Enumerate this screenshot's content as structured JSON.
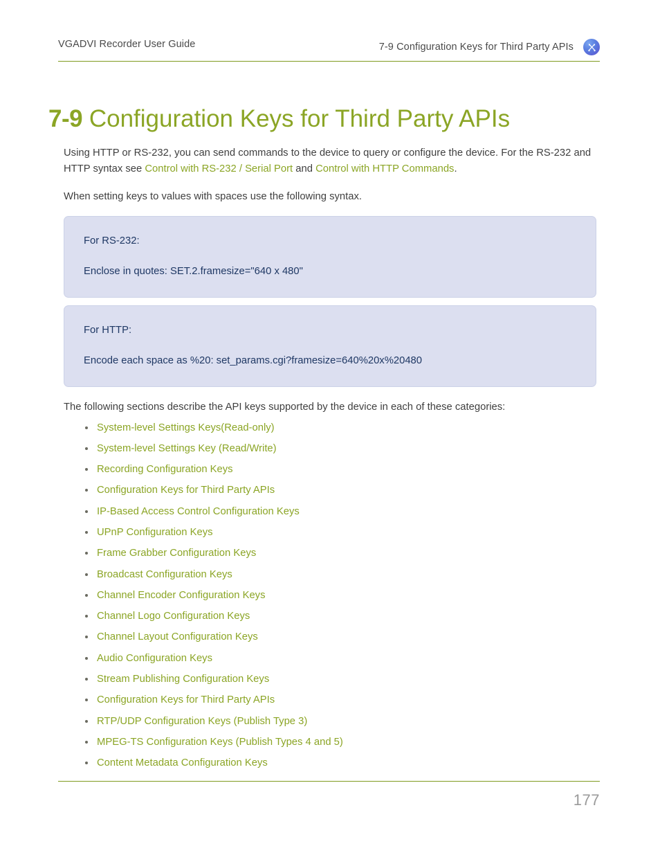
{
  "header": {
    "left_title": "VGADVI Recorder User Guide",
    "right_title": "7-9 Configuration Keys for Third Party APIs",
    "badge_icon": "tools-icon"
  },
  "title": {
    "number": "7-9",
    "text": "Configuration Keys for Third Party APIs"
  },
  "body": {
    "paragraph1_part1": "Using HTTP or RS-232, you can send commands to the device to query or configure the device. For the RS-232 and HTTP syntax see ",
    "paragraph1_link1": "Control with RS-232 / Serial Port",
    "paragraph1_part2": " and ",
    "paragraph1_link2": "Control with HTTP Commands",
    "paragraph1_part3": ".",
    "paragraph2": "When setting keys to values with spaces use the following syntax.",
    "list_intro": "The following sections describe the API keys supported by the device in each of these categories:"
  },
  "callouts": [
    {
      "heading": "For RS-232:",
      "detail": "Enclose in quotes: SET.2.framesize=\"640 x 480\""
    },
    {
      "heading": "For HTTP:",
      "detail": "Encode each space as %20: set_params.cgi?framesize=640%20x%20480"
    }
  ],
  "link_list": [
    {
      "label": "System-level Settings Keys(Read-only)"
    },
    {
      "label": "System-level Settings Key (Read/Write)"
    },
    {
      "label": "Recording Configuration Keys"
    },
    {
      "label": "Configuration Keys for Third Party APIs"
    },
    {
      "label": "IP-Based Access Control Configuration Keys"
    },
    {
      "label": "UPnP Configuration Keys"
    },
    {
      "label": "Frame Grabber Configuration Keys"
    },
    {
      "label": "Broadcast Configuration Keys"
    },
    {
      "label": "Channel Encoder Configuration Keys"
    },
    {
      "label": "Channel Logo Configuration Keys"
    },
    {
      "label": "Channel Layout Configuration Keys"
    },
    {
      "label": "Audio Configuration Keys"
    },
    {
      "label": "Stream Publishing Configuration Keys"
    },
    {
      "label": "Configuration Keys for Third Party APIs"
    },
    {
      "label": "RTP/UDP Configuration Keys (Publish Type 3)"
    },
    {
      "label": "MPEG-TS Configuration Keys (Publish Types 4 and 5)"
    },
    {
      "label": "Content Metadata Configuration Keys"
    }
  ],
  "footer": {
    "page_number": "177"
  },
  "colors": {
    "accent_green": "#8ba525",
    "rule_green": "#7f9a1e",
    "callout_bg": "#dcdff0",
    "callout_text": "#1f3864",
    "body_text": "#3f3f3f",
    "page_number": "#9a9a9a"
  }
}
